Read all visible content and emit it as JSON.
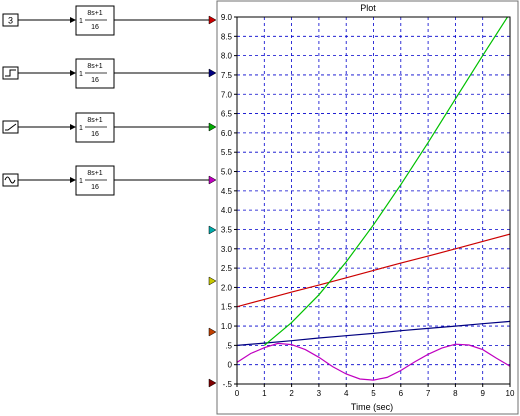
{
  "blocks": [
    {
      "source_label": "3",
      "source_icon": "constant-icon",
      "gain": "1",
      "numerator": "8s+1",
      "denominator": "16"
    },
    {
      "source_label": "",
      "source_icon": "step-icon",
      "gain": "1",
      "numerator": "8s+1",
      "denominator": "16"
    },
    {
      "source_label": "",
      "source_icon": "ramp-icon",
      "gain": "1",
      "numerator": "8s+1",
      "denominator": "16"
    },
    {
      "source_label": "",
      "source_icon": "sine-wave-icon",
      "gain": "1",
      "numerator": "8s+1",
      "denominator": "16"
    }
  ],
  "port_colors": [
    "#cc0000",
    "#000080",
    "#00aa00",
    "#c000c0",
    "#00aaaa",
    "#c8c800",
    "#c04000",
    "#800000"
  ],
  "chart_data": {
    "type": "line",
    "title": "Plot",
    "xlabel": "Time (sec)",
    "ylabel": "",
    "xlim": [
      0,
      10
    ],
    "ylim": [
      -0.5,
      9.0
    ],
    "x_ticks": [
      "0",
      "1",
      "2",
      "3",
      "4",
      "5",
      "6",
      "7",
      "8",
      "9",
      "10"
    ],
    "y_ticks": [
      "-.5",
      "0",
      ".5",
      "1.0",
      "1.5",
      "2.0",
      "2.5",
      "3.0",
      "3.5",
      "4.0",
      "4.5",
      "5.0",
      "5.5",
      "6.0",
      "6.5",
      "7.0",
      "7.5",
      "8.0",
      "8.5",
      "9.0"
    ],
    "grid": true,
    "series": [
      {
        "color": "#cc0000",
        "x": [
          0,
          1,
          2,
          3,
          4,
          5,
          6,
          7,
          8,
          9,
          10
        ],
        "y": [
          1.5,
          1.69,
          1.88,
          2.06,
          2.25,
          2.44,
          2.63,
          2.81,
          3.0,
          3.19,
          3.38
        ]
      },
      {
        "color": "#000080",
        "x": [
          0,
          1,
          2,
          3,
          4,
          5,
          6,
          7,
          8,
          9,
          10
        ],
        "y": [
          0.5,
          0.56,
          0.62,
          0.69,
          0.75,
          0.81,
          0.88,
          0.94,
          1.0,
          1.06,
          1.12
        ]
      },
      {
        "color": "#00c000",
        "x": [
          1.0,
          2,
          3,
          4,
          5,
          6,
          7,
          8,
          9,
          10
        ],
        "y": [
          0.5,
          1.09,
          1.81,
          2.66,
          3.62,
          4.66,
          5.75,
          6.88,
          8.0,
          9.1
        ]
      },
      {
        "color": "#c000c0",
        "x": [
          0,
          0.5,
          1,
          1.5,
          2,
          2.5,
          3,
          3.5,
          4,
          4.5,
          5,
          5.5,
          6,
          6.5,
          7,
          7.5,
          8,
          8.5,
          9,
          9.5,
          10
        ],
        "y": [
          0.06,
          0.29,
          0.44,
          0.55,
          0.52,
          0.39,
          0.19,
          -0.05,
          -0.24,
          -0.37,
          -0.4,
          -0.33,
          -0.15,
          0.07,
          0.27,
          0.43,
          0.53,
          0.51,
          0.39,
          0.17,
          -0.04
        ]
      }
    ]
  }
}
